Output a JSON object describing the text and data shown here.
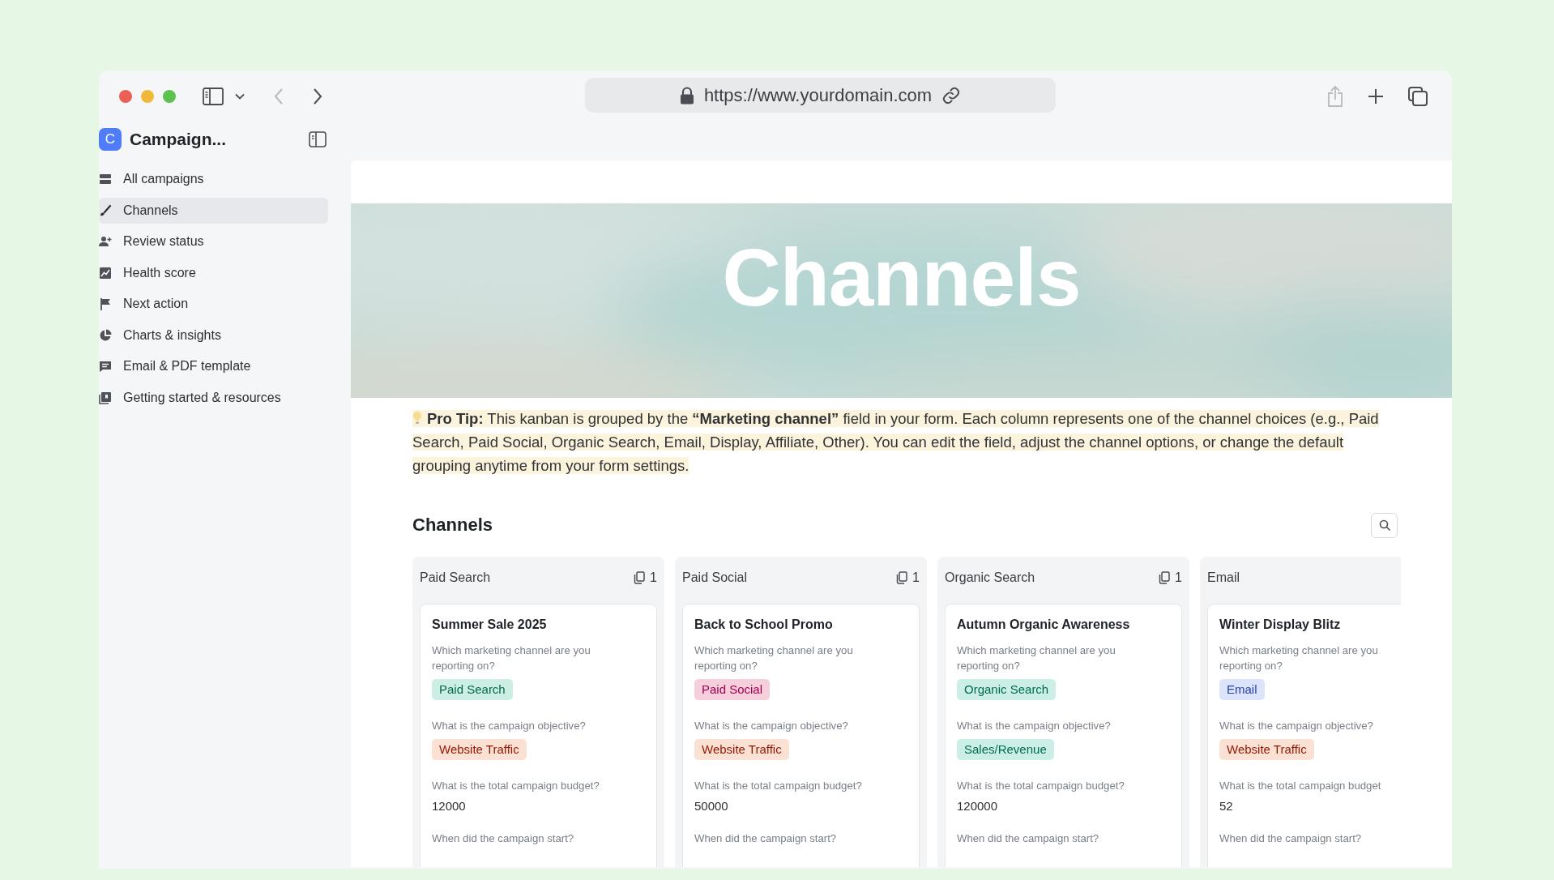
{
  "browser": {
    "url": "https://www.yourdomain.com",
    "back": {
      "disabled": true
    },
    "forward": {
      "disabled": false
    },
    "share": {
      "disabled": true
    }
  },
  "sidebar": {
    "workspace_initial": "C",
    "workspace_name": "Campaign...",
    "items": [
      {
        "label": "All campaigns",
        "selected": false
      },
      {
        "label": "Channels",
        "selected": true
      },
      {
        "label": "Review status",
        "selected": false
      },
      {
        "label": "Health score",
        "selected": false
      },
      {
        "label": "Next action",
        "selected": false
      },
      {
        "label": "Charts & insights",
        "selected": false
      },
      {
        "label": "Email & PDF template",
        "selected": false
      },
      {
        "label": "Getting started & resources",
        "selected": false
      }
    ]
  },
  "page": {
    "title": "Channels",
    "pro_tip": "**Pro Tip:** This kanban is grouped by the **“Marketing channel”** field in your form. Each column represents one of the channel choices (e.g., Paid Search, Paid Social, Organic Search, Email, Display, Affiliate, Other). You can edit the field, adjust the channel options, or change the default grouping anytime from your form settings.",
    "board": {
      "title": "Channels",
      "columns": [
        {
          "name": "Paid Search",
          "count": "1",
          "cards": [
            {
              "title": "Summer Sale 2025",
              "fields": [
                {
                  "kind": "tag",
                  "label": "Which marketing channel are you reporting on?",
                  "value": "Paid Search",
                  "color": "#cdeee5"
                },
                {
                  "kind": "tag",
                  "label": "What is the campaign objective?",
                  "value": "Website Traffic",
                  "color": "#fbe0d4"
                },
                {
                  "kind": "text",
                  "label": "What is the total campaign budget?",
                  "value": "12000"
                },
                {
                  "kind": "question",
                  "label": "When did the campaign start?"
                }
              ]
            }
          ]
        },
        {
          "name": "Paid Social",
          "count": "1",
          "cards": [
            {
              "title": "Back to School Promo",
              "fields": [
                {
                  "kind": "tag",
                  "label": "Which marketing channel are you reporting on?",
                  "value": "Paid Social",
                  "color": "#f6cfdc"
                },
                {
                  "kind": "tag",
                  "label": "What is the campaign objective?",
                  "value": "Website Traffic",
                  "color": "#fbe0d4"
                },
                {
                  "kind": "text",
                  "label": "What is the total campaign budget?",
                  "value": "50000"
                },
                {
                  "kind": "question",
                  "label": "When did the campaign start?"
                }
              ]
            }
          ]
        },
        {
          "name": "Organic Search",
          "count": "1",
          "cards": [
            {
              "title": "Autumn Organic Awareness",
              "fields": [
                {
                  "kind": "tag",
                  "label": "Which marketing channel are you reporting on?",
                  "value": "Organic Search",
                  "color": "#cbefe6"
                },
                {
                  "kind": "tag",
                  "label": "What is the campaign objective?",
                  "value": "Sales/Revenue",
                  "color": "#cbefe6"
                },
                {
                  "kind": "text",
                  "label": "What is the total campaign budget?",
                  "value": "120000"
                },
                {
                  "kind": "question",
                  "label": "When did the campaign start?"
                }
              ]
            }
          ]
        },
        {
          "name": "Email",
          "cards": [
            {
              "title": "Winter Display Blitz",
              "fields": [
                {
                  "kind": "tag",
                  "label": "Which marketing channel are you reporting on?",
                  "value": "Email",
                  "color": "#dbe4fb"
                },
                {
                  "kind": "tag",
                  "label": "What is the campaign objective?",
                  "value": "Website Traffic",
                  "color": "#fbe0d4"
                },
                {
                  "kind": "text",
                  "label": "What is the total campaign budget",
                  "value": "52"
                },
                {
                  "kind": "question",
                  "label": "When did the campaign start?"
                }
              ]
            }
          ]
        }
      ]
    }
  }
}
